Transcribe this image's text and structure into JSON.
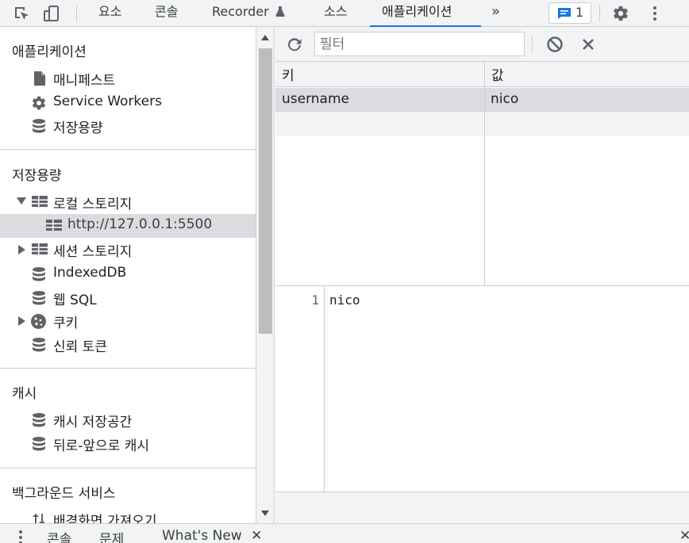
{
  "top_tabs": [
    "요소",
    "콘솔",
    "Recorder",
    "소스",
    "애플리케이션"
  ],
  "issues_badge_count": "1",
  "sidebar": {
    "application": {
      "title": "애플리케이션",
      "items": [
        "매니페스트",
        "Service Workers",
        "저장용량"
      ]
    },
    "storage": {
      "title": "저장용량",
      "local_storage": "로컬 스토리지",
      "local_origin": "http://127.0.0.1:5500",
      "session_storage": "세션 스토리지",
      "indexeddb": "IndexedDB",
      "websql": "웹 SQL",
      "cookies": "쿠키",
      "trust_tokens": "신뢰 토큰"
    },
    "cache": {
      "title": "캐시",
      "items": [
        "캐시 저장공간",
        "뒤로-앞으로 캐시"
      ]
    },
    "background": {
      "title": "백그라운드 서비스",
      "items": [
        "배경화면 가져오기"
      ]
    }
  },
  "storage_view": {
    "filter_placeholder": "필터",
    "columns": [
      "키",
      "값"
    ],
    "rows": [
      {
        "key": "username",
        "value": "nico"
      }
    ],
    "preview_line_number": "1",
    "preview_value": "nico"
  },
  "drawer": {
    "tabs": [
      "콘솔",
      "문제",
      "What's New"
    ]
  },
  "colors": {
    "accent": "#1a73e8",
    "selected_row": "#dadce0",
    "toolbar_bg": "#f1f3f4"
  }
}
